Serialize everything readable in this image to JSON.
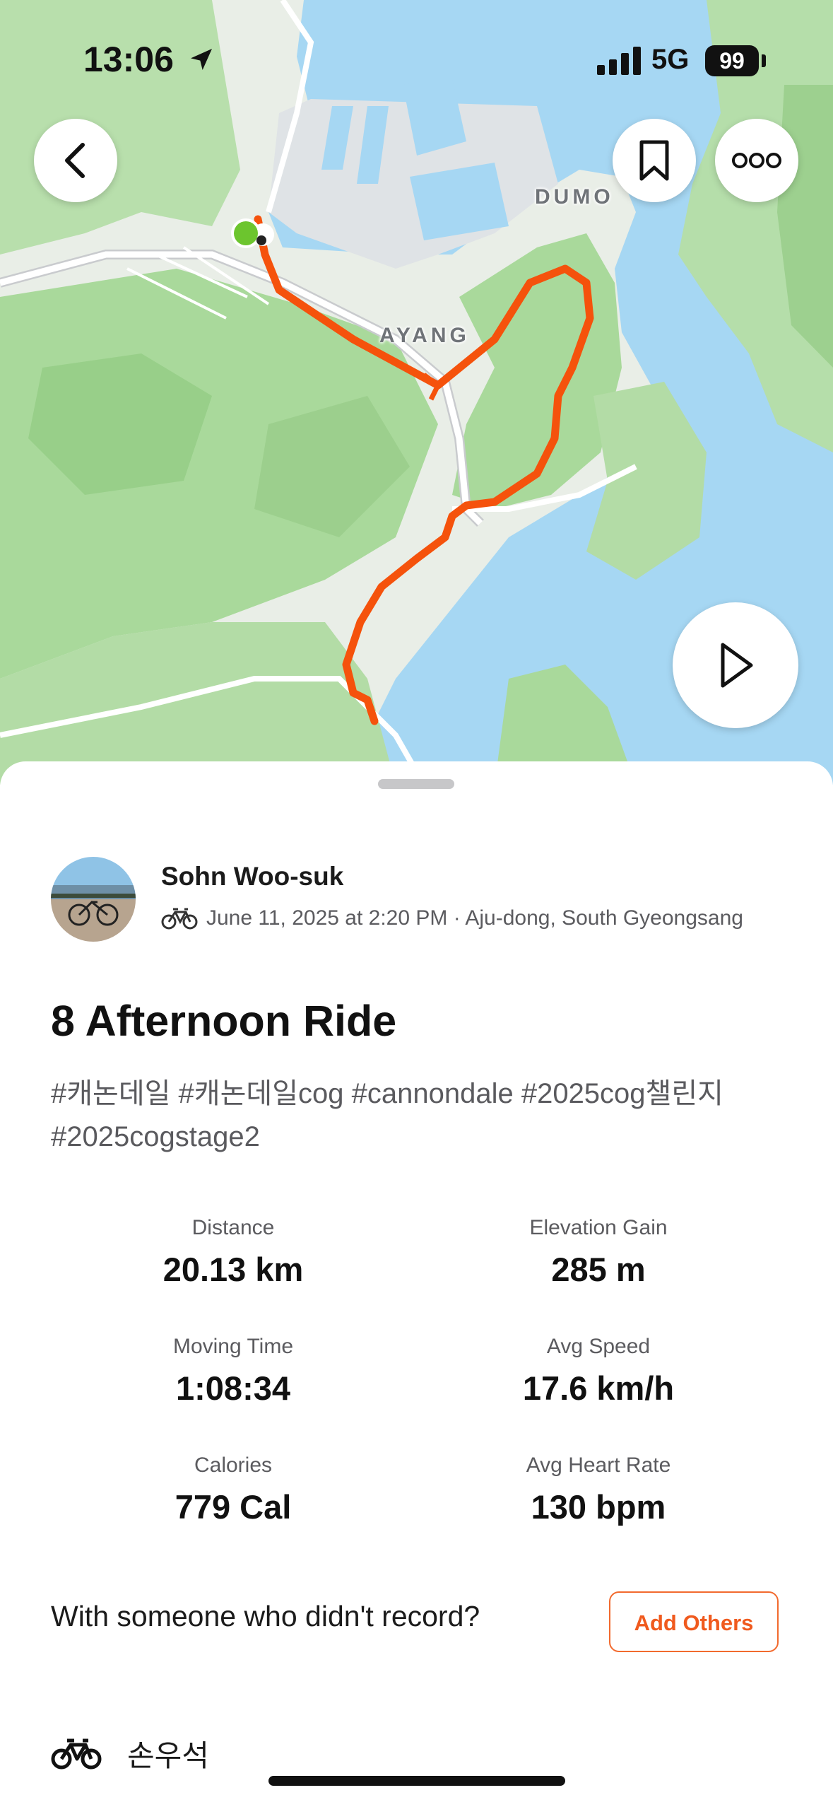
{
  "status_bar": {
    "time": "13:06",
    "network": "5G",
    "battery": "99",
    "icons": [
      "location-arrow-icon",
      "cellular-signal-icon"
    ]
  },
  "map": {
    "labels": {
      "dumo": "DUMO",
      "ayang": "AYANG"
    },
    "route_color": "#f5520c",
    "start_marker_color": "#6cc52e",
    "buttons": [
      "back-chevron-icon",
      "bookmark-icon",
      "more-options-icon",
      "play-icon"
    ]
  },
  "activity": {
    "athlete_name": "Sohn Woo-suk",
    "sport_icon": "bike-icon",
    "meta": "June 11, 2025 at 2:20 PM · Aju-dong, South Gyeongsang",
    "title": "8 Afternoon Ride",
    "description": "#캐논데일 #캐논데일cog #cannondale #2025cog챌린지 #2025cogstage2",
    "stats": [
      {
        "label": "Distance",
        "value": "20.13 km"
      },
      {
        "label": "Elevation Gain",
        "value": "285 m"
      },
      {
        "label": "Moving Time",
        "value": "1:08:34"
      },
      {
        "label": "Avg Speed",
        "value": "17.6 km/h"
      },
      {
        "label": "Calories",
        "value": "779 Cal"
      },
      {
        "label": "Avg Heart Rate",
        "value": "130 bpm"
      }
    ]
  },
  "others": {
    "prompt": "With someone who didn't record?",
    "button": "Add Others"
  },
  "equipment": {
    "icon": "bike-icon",
    "name": "손우석"
  },
  "colors": {
    "accent": "#f05a1e",
    "text": "#1b1b1b",
    "muted": "#5b5b5f",
    "water": "#a7d8f4",
    "land": "#e6ece5",
    "forest": "#a8d99a"
  }
}
